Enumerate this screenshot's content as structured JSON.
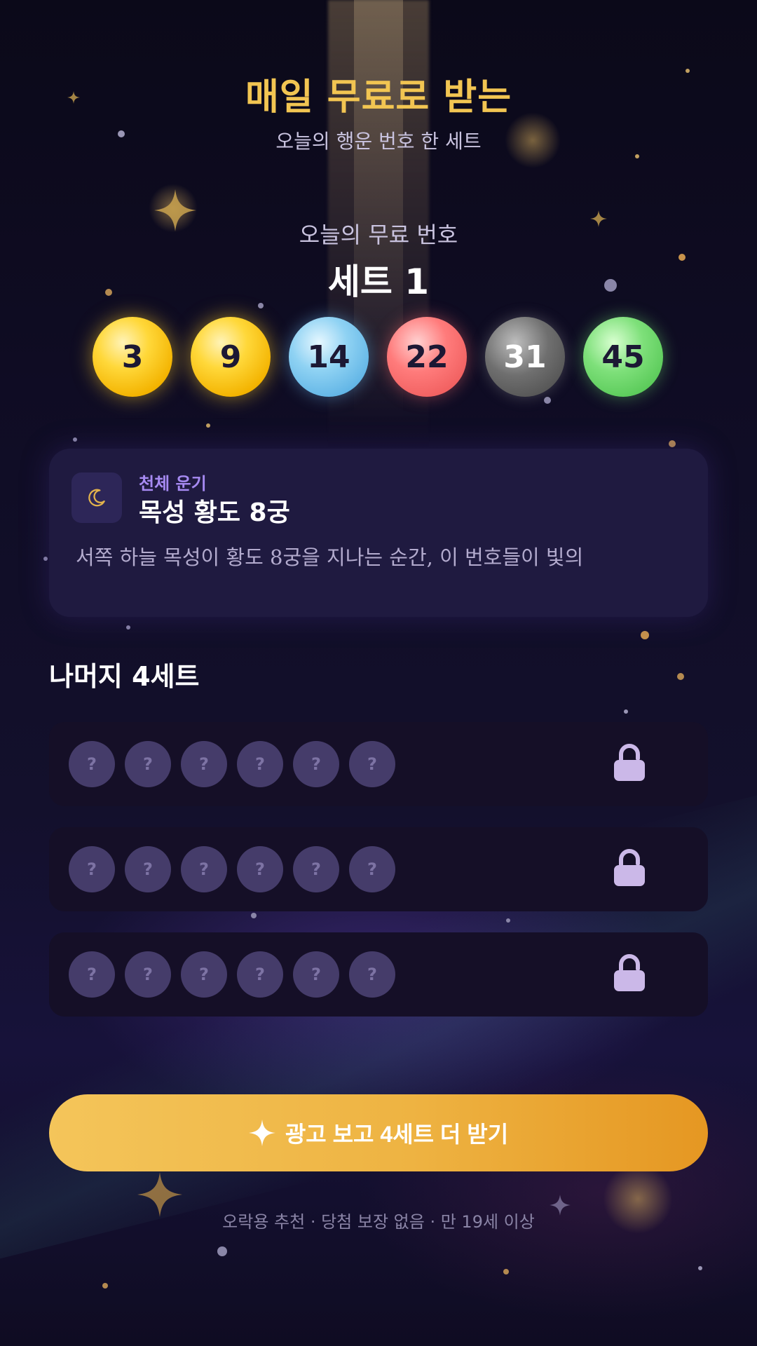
{
  "header": {
    "title": "매일 무료로 받는",
    "subtitle": "오늘의 행운 번호 한 세트"
  },
  "free_set": {
    "label": "오늘의 무료 번호",
    "title": "세트 1",
    "numbers": [
      "3",
      "9",
      "14",
      "22",
      "31",
      "45"
    ]
  },
  "fortune": {
    "icon": "moon-icon",
    "category": "천체 운기",
    "title": "목성 황도 8궁",
    "body": "서쪽 하늘 목성이 황도 8궁을 지나는 순간, 이 번호들이 빛의"
  },
  "locked": {
    "title": "나머지 4세트",
    "placeholder": "?",
    "lock_icon": "lock-icon"
  },
  "cta": {
    "icon": "sparkle-icon",
    "label": "광고 보고 4세트 더 받기"
  },
  "footer": {
    "disclaimer": "오락용 추천 · 당첨 보장 없음 · 만 19세 이상"
  },
  "colors": {
    "accent_gold": "#f2c552",
    "ball_yellow": "#ffd83a",
    "ball_blue": "#8fd2f3",
    "ball_red": "#ff7b7b",
    "ball_gray": "#6f6f6f",
    "ball_green": "#7ee07a",
    "category_purple": "#a68af2"
  }
}
